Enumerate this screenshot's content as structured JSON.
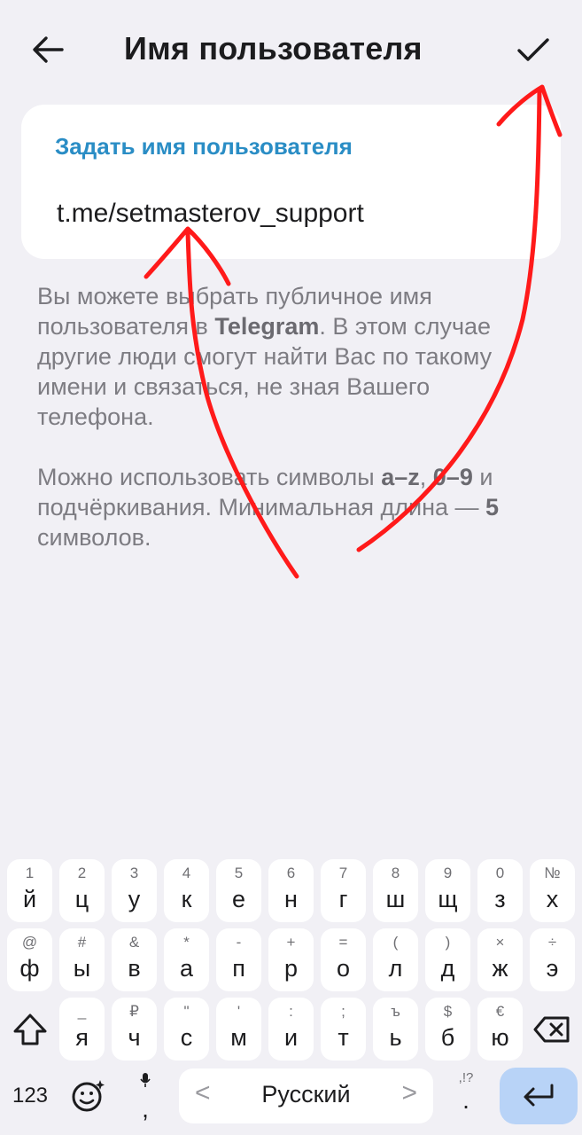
{
  "header": {
    "title": "Имя пользователя"
  },
  "field": {
    "label": "Задать имя пользователя",
    "value": "t.me/setmasterov_support"
  },
  "description": {
    "p1_a": "Вы можете выбрать публичное имя пользователя в ",
    "p1_bold": "Telegram",
    "p1_b": ". В этом случае другие люди смогут найти Вас по такому имени и связаться, не зная Вашего телефона.",
    "p2_a": "Можно использовать символы ",
    "p2_bold1": "a–z",
    "p2_sep1": ", ",
    "p2_bold2": "0–9",
    "p2_b": " и подчёркивания. Минимальная длина — ",
    "p2_bold3": "5",
    "p2_c": " символов."
  },
  "colors": {
    "accent": "#2a8dc5",
    "annotation": "#ff1a1a",
    "enter_key": "#b8d3f7"
  },
  "keyboard": {
    "row1": [
      {
        "hint": "1",
        "main": "й"
      },
      {
        "hint": "2",
        "main": "ц"
      },
      {
        "hint": "3",
        "main": "у"
      },
      {
        "hint": "4",
        "main": "к"
      },
      {
        "hint": "5",
        "main": "е"
      },
      {
        "hint": "6",
        "main": "н"
      },
      {
        "hint": "7",
        "main": "г"
      },
      {
        "hint": "8",
        "main": "ш"
      },
      {
        "hint": "9",
        "main": "щ"
      },
      {
        "hint": "0",
        "main": "з"
      },
      {
        "hint": "№",
        "main": "х"
      }
    ],
    "row2": [
      {
        "hint": "@",
        "main": "ф"
      },
      {
        "hint": "#",
        "main": "ы"
      },
      {
        "hint": "&",
        "main": "в"
      },
      {
        "hint": "*",
        "main": "а"
      },
      {
        "hint": "-",
        "main": "п"
      },
      {
        "hint": "+",
        "main": "р"
      },
      {
        "hint": "=",
        "main": "о"
      },
      {
        "hint": "(",
        "main": "л"
      },
      {
        "hint": ")",
        "main": "д"
      },
      {
        "hint": "×",
        "main": "ж"
      },
      {
        "hint": "÷",
        "main": "э"
      }
    ],
    "row3": [
      {
        "hint": "_",
        "main": "я"
      },
      {
        "hint": "₽",
        "main": "ч"
      },
      {
        "hint": "\"",
        "main": "с"
      },
      {
        "hint": "'",
        "main": "м"
      },
      {
        "hint": ":",
        "main": "и"
      },
      {
        "hint": ";",
        "main": "т"
      },
      {
        "hint": "ъ",
        "main": "ь"
      },
      {
        "hint": "$",
        "main": "б"
      },
      {
        "hint": "€",
        "main": "ю"
      }
    ],
    "numbers_label": "123",
    "comma": ",",
    "space_label": "Русский",
    "space_left_arrow": "<",
    "space_right_arrow": ">",
    "punct_hint": ",!?",
    "punct_main": "."
  }
}
